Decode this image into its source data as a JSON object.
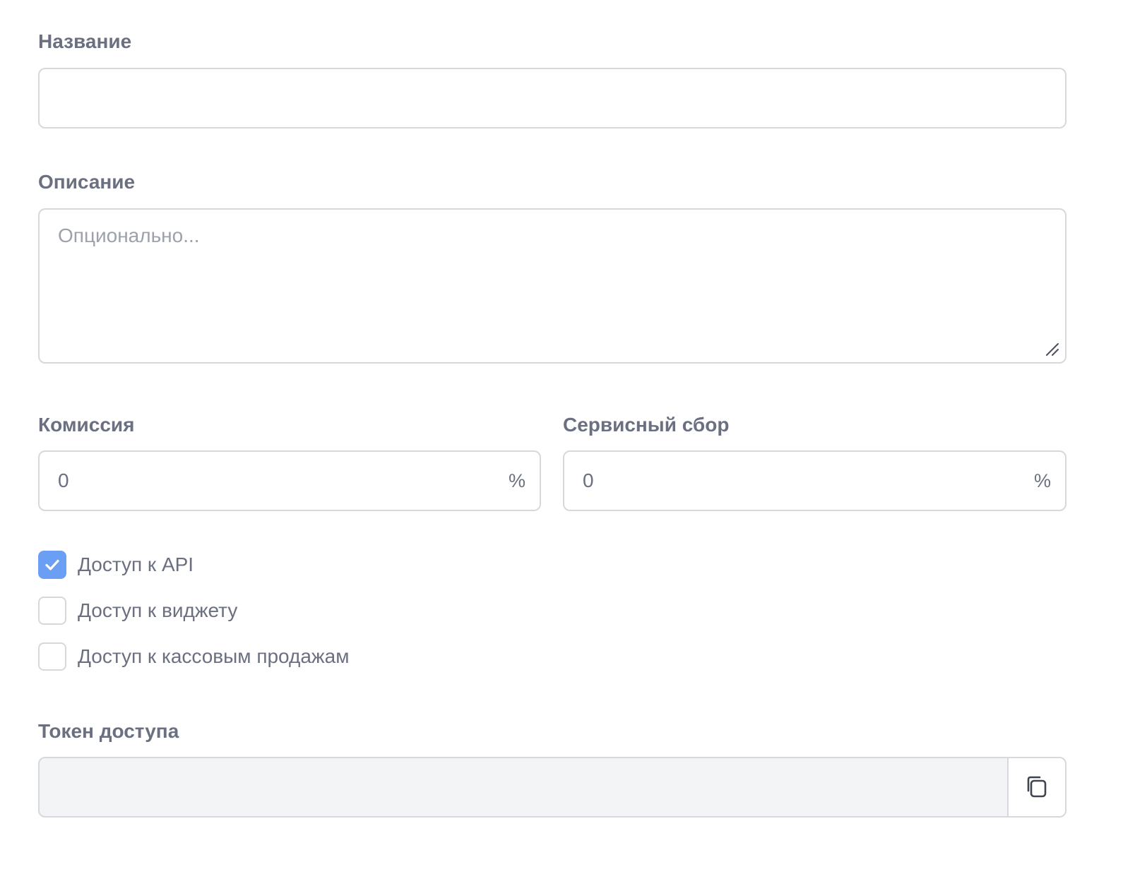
{
  "form": {
    "name": {
      "label": "Название",
      "value": ""
    },
    "description": {
      "label": "Описание",
      "placeholder": "Опционально..."
    },
    "commission": {
      "label": "Комиссия",
      "value": "0",
      "suffix": "%"
    },
    "service_fee": {
      "label": "Сервисный сбор",
      "value": "0",
      "suffix": "%"
    },
    "access": [
      {
        "label": "Доступ к API",
        "checked": true
      },
      {
        "label": "Доступ к виджету",
        "checked": false
      },
      {
        "label": "Доступ к кассовым продажам",
        "checked": false
      }
    ],
    "token": {
      "label": "Токен доступа",
      "value": ""
    }
  },
  "icons": {
    "checkmark": "check-icon",
    "copy": "copy-icon",
    "resize": "resize-grip-icon"
  },
  "colors": {
    "accent": "#6b9ff3",
    "label": "#6b7080",
    "border": "#d6d8dd",
    "readonly_bg": "#f3f4f6"
  }
}
